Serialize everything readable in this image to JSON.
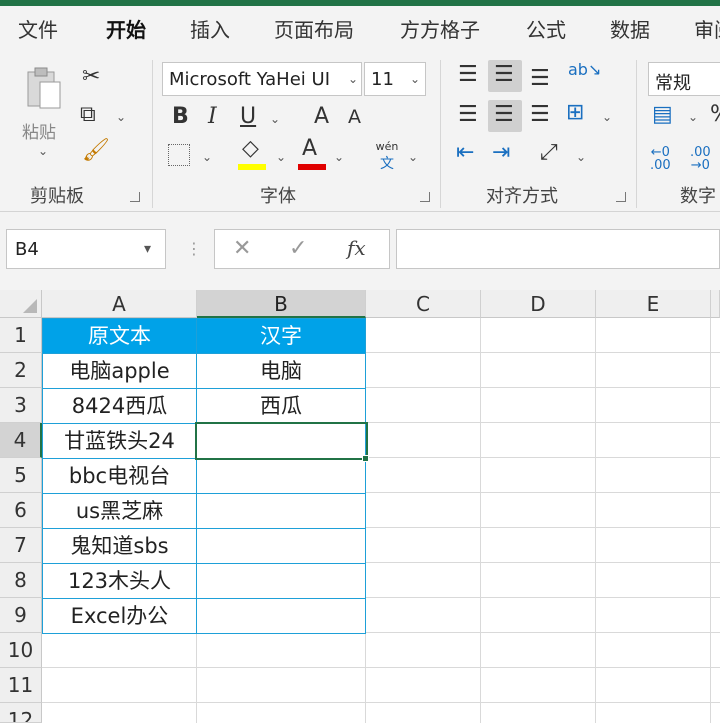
{
  "tabs": [
    {
      "label": "文件"
    },
    {
      "label": "开始"
    },
    {
      "label": "插入"
    },
    {
      "label": "页面布局"
    },
    {
      "label": "方方格子"
    },
    {
      "label": "公式"
    },
    {
      "label": "数据"
    },
    {
      "label": "审阅"
    }
  ],
  "ribbon": {
    "clipboard": {
      "paste_label": "粘贴",
      "group_label": "剪贴板"
    },
    "font": {
      "font_name": "Microsoft YaHei UI",
      "font_size": "11",
      "group_label": "字体",
      "bold": "B",
      "italic": "I",
      "underline": "U",
      "grow": "A",
      "shrink": "A",
      "wen_top": "wén",
      "wen_bottom": "文"
    },
    "alignment": {
      "group_label": "对齐方式"
    },
    "number": {
      "format": "常规",
      "group_label": "数字"
    }
  },
  "formula_bar": {
    "name_box": "B4",
    "fx": "fx",
    "formula": ""
  },
  "colors": {
    "accent": "#217346",
    "header_fill": "#00a2e8",
    "font_color_bar": "#e00000",
    "highlight_bar": "#ffff00"
  },
  "sheet": {
    "columns": [
      "A",
      "B",
      "C",
      "D",
      "E"
    ],
    "rows": [
      "1",
      "2",
      "3",
      "4",
      "5",
      "6",
      "7",
      "8",
      "9",
      "10",
      "11",
      "12"
    ],
    "table": [
      [
        "原文本",
        "汉字"
      ],
      [
        "电脑apple",
        "电脑"
      ],
      [
        "8424西瓜",
        "西瓜"
      ],
      [
        "甘蓝铁头24",
        ""
      ],
      [
        "bbc电视台",
        ""
      ],
      [
        "us黑芝麻",
        ""
      ],
      [
        "鬼知道sbs",
        ""
      ],
      [
        "123木头人",
        ""
      ],
      [
        "Excel办公",
        ""
      ]
    ],
    "active_cell": "B4"
  }
}
